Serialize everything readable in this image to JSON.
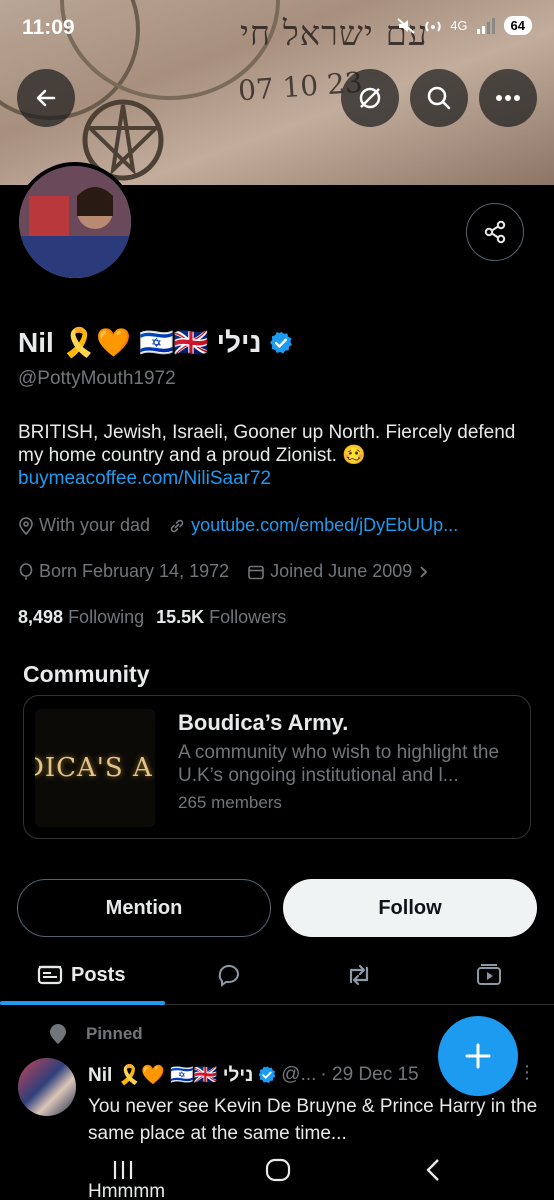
{
  "status_bar": {
    "time": "11:09",
    "network": "4G",
    "battery": "64"
  },
  "banner": {
    "tattoo_text": "עם ישראל חי",
    "tattoo_date": "07 10 23"
  },
  "header_actions": [
    "back-icon",
    "grok-icon",
    "search-icon",
    "more-icon"
  ],
  "profile": {
    "name": "Nil 🎗️🧡 🇮🇱🇬🇧 נילי",
    "handle": "@PottyMouth1972",
    "bio": "BRITISH, Jewish, Israeli, Gooner up North. Fiercely defend my home country and a proud Zionist. 🥴",
    "bio_link": "buymeacoffee.com/NiliSaar72",
    "location": "With your dad",
    "website": "youtube.com/embed/jDyEbUUp...",
    "born": "Born February 14, 1972",
    "joined": "Joined June 2009",
    "following_count": "8,498",
    "following_label": "Following",
    "followers_count": "15.5K",
    "followers_label": "Followers"
  },
  "community": {
    "section_title": "Community",
    "image_text": "DICA'S A",
    "name": "Boudica’s Army.",
    "description": "A community who wish to highlight the U.K’s ongoing institutional and l...",
    "members": "265 members"
  },
  "actions": {
    "mention": "Mention",
    "follow": "Follow"
  },
  "tabs": {
    "posts": "Posts"
  },
  "post": {
    "pinned_label": "Pinned",
    "author": "Nil 🎗️🧡 🇮🇱🇬🇧 נילי",
    "handle_meta": "@...",
    "date": "· 29 Dec 15",
    "text": "You never see Kevin De Bruyne & Prince Harry in the same place at the same time...",
    "next_line": "Hmmmm"
  },
  "colors": {
    "accent": "#1d9bf0",
    "background": "#000000",
    "secondary_text": "#71767b"
  }
}
